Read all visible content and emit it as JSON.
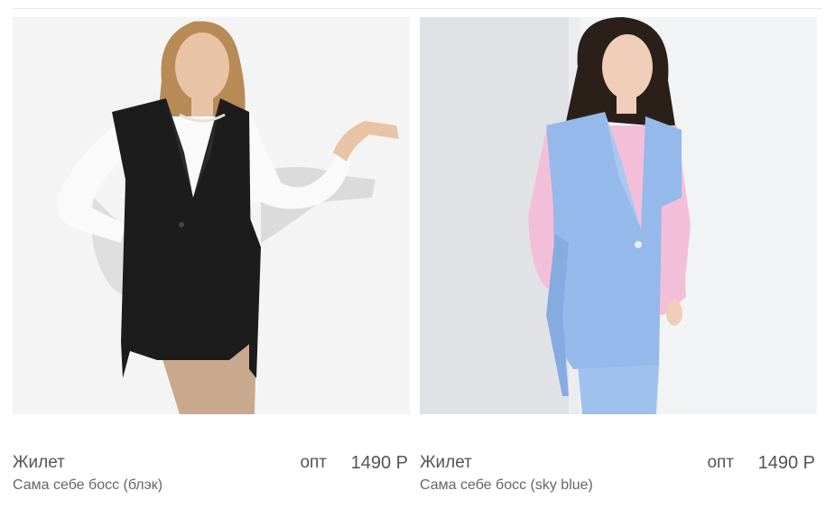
{
  "products": [
    {
      "name": "Жилет",
      "subtitle": "Сама себе босс (блэк)",
      "price_label": "опт",
      "price": "1490 Р",
      "image_icon": "product-photo-black-vest",
      "colors": {
        "background": "#f4f4f4",
        "garment": "#1c1c1c",
        "shirt": "#fafafa",
        "trousers": "#c9a98e",
        "skin": "#e8c3a6",
        "hair": "#b88a55"
      }
    },
    {
      "name": "Жилет",
      "subtitle": "Сама себе босс (sky blue)",
      "price_label": "опт",
      "price": "1490 Р",
      "image_icon": "product-photo-sky-blue-vest",
      "colors": {
        "background": "#f2f3f5",
        "garment": "#95b9ea",
        "shirt": "#f3bfd8",
        "trousers": "#9ec1ee",
        "skin": "#f0cdb8",
        "hair": "#2b2019"
      }
    }
  ]
}
